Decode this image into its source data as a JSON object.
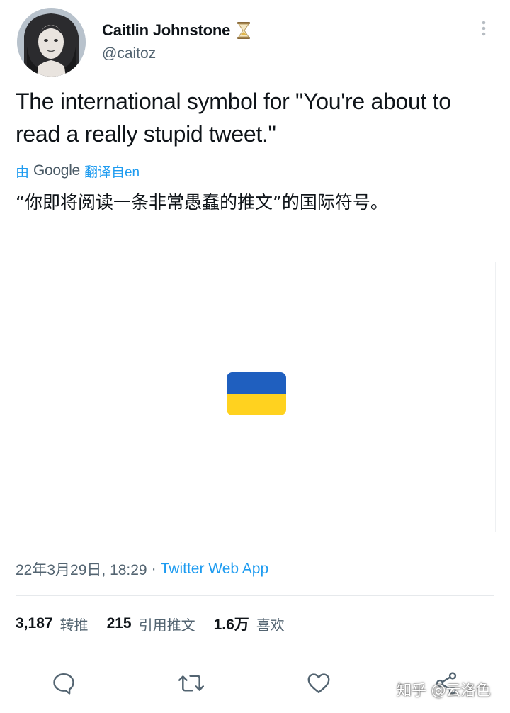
{
  "author": {
    "display_name": "Caitlin Johnstone",
    "handle": "@caitoz",
    "badge_icon": "hourglass-icon"
  },
  "tweet": {
    "text": "The international symbol for \"You're about to read a really stupid tweet.\"",
    "translation_prefix": "由",
    "translation_provider": "Google",
    "translation_suffix": "翻译自en",
    "translated_text": "“你即将阅读一条非常愚蠢的推文”的国际符号。",
    "media": {
      "type": "emoji-flag",
      "description_icon": "ukraine-flag-icon",
      "colors": {
        "top": "#1f5fbf",
        "bottom": "#ffd21f"
      }
    },
    "timestamp": "22年3月29日, 18:29",
    "separator": "·",
    "source": "Twitter Web App"
  },
  "stats": [
    {
      "num": "3,187",
      "label": "转推"
    },
    {
      "num": "215",
      "label": "引用推文"
    },
    {
      "num": "1.6万",
      "label": "喜欢"
    }
  ],
  "actions": [
    "reply-icon",
    "retweet-icon",
    "like-icon",
    "share-icon"
  ],
  "watermark": "知乎 @云洛色",
  "colors": {
    "accent": "#1d9bf0",
    "secondary_text": "#536471",
    "primary_text": "#0f1419"
  }
}
